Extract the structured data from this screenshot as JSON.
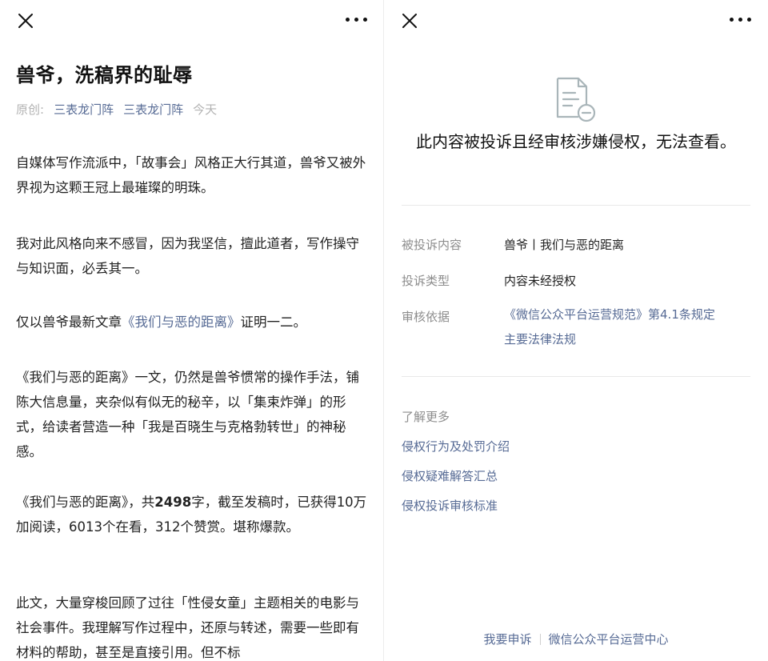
{
  "left": {
    "title": "兽爷，洗稿界的耻辱",
    "meta": {
      "original": "原创:",
      "author1": "三表龙门阵",
      "author2": "三表龙门阵",
      "time": "今天"
    },
    "paragraphs": {
      "p1": "自媒体写作流派中，「故事会」风格正大行其道，兽爷又被外界视为这颗王冠上最璀璨的明珠。",
      "p2": "我对此风格向来不感冒，因为我坚信，擅此道者，写作操守与知识面，必丢其一。",
      "p3_before": "仅以兽爷最新文章",
      "p3_link": "《我们与恶的距离》",
      "p3_after": "证明一二。",
      "p4": "《我们与恶的距离》一文，仍然是兽爷惯常的操作手法，铺陈大信息量，夹杂似有似无的秘辛，以「集束炸弹」的形式，给读者营造一种「我是百晓生与克格勃转世」的神秘感。",
      "p5_before": "《我们与恶的距离》，共",
      "p5_bold": "2498",
      "p5_after": "字，截至发稿时，已获得10万加阅读，6013个在看，312个赞赏。堪称爆款。",
      "p6": "此文，大量穿梭回顾了过往「性侵女童」主题相关的电影与社会事件。我理解写作过程中，还原与转述，需要一些即有材料的帮助，甚至是直接引用。但不标"
    }
  },
  "right": {
    "notice": "此内容被投诉且经审核涉嫌侵权，无法查看。",
    "rows": {
      "complaint_content_label": "被投诉内容",
      "complaint_content_value": "兽爷丨我们与恶的距离",
      "complaint_type_label": "投诉类型",
      "complaint_type_value": "内容未经授权",
      "basis_label": "审核依据",
      "basis_value_line1": "《微信公众平台运营规范》第4.1条规定",
      "basis_value_line2": "主要法律法规"
    },
    "learn_more": {
      "title": "了解更多",
      "links": [
        "侵权行为及处罚介绍",
        "侵权疑难解答汇总",
        "侵权投诉审核标准"
      ]
    },
    "footer": {
      "appeal": "我要申诉",
      "center": "微信公众平台运营中心"
    }
  },
  "colors": {
    "link": "#576b95",
    "muted": "#8d8d8d",
    "text": "#222222",
    "accent_icon": "#a9b5b9"
  },
  "icons": {
    "close": "close-icon",
    "more": "more-icon",
    "document": "document-minus-icon"
  }
}
